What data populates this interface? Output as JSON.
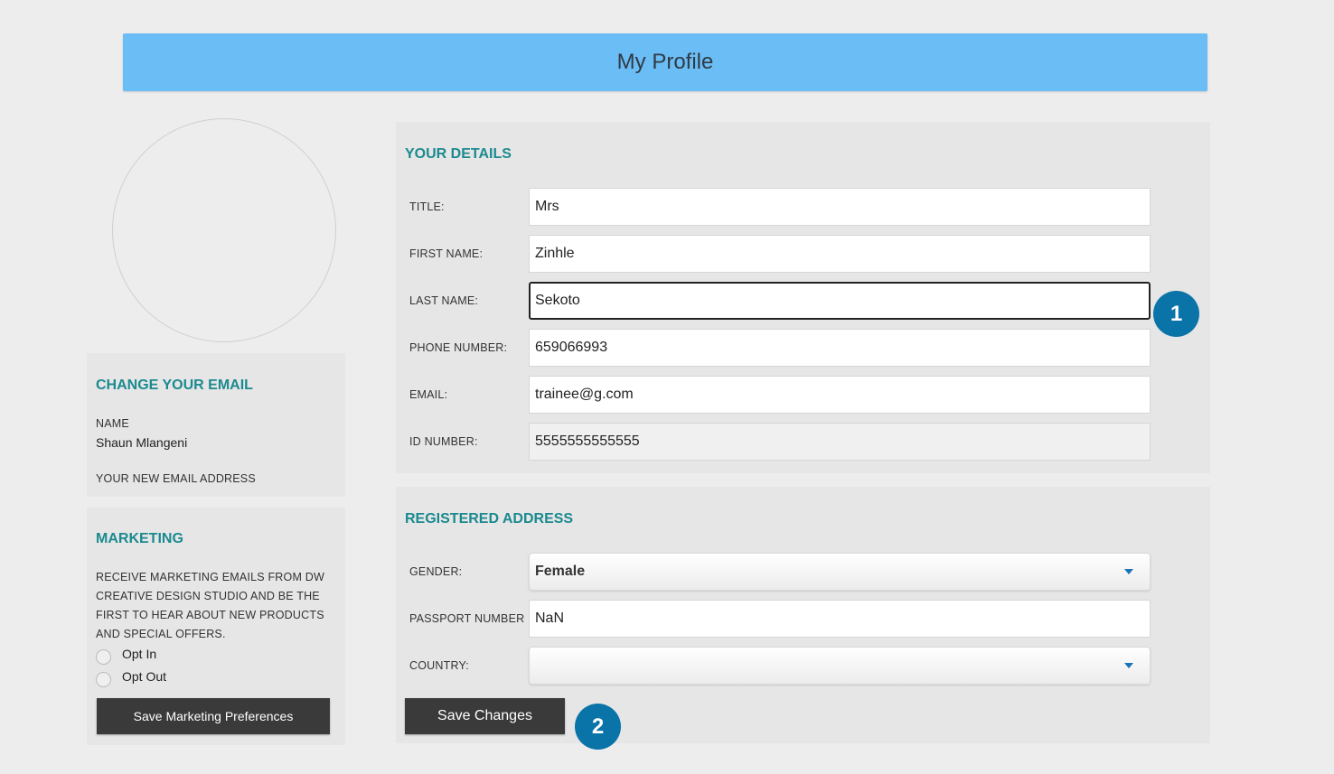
{
  "header": {
    "title": "My Profile"
  },
  "email_section": {
    "heading": "CHANGE YOUR EMAIL",
    "name_label": "NAME",
    "name_value": "Shaun Mlangeni",
    "new_email_label": "YOUR NEW EMAIL ADDRESS"
  },
  "marketing": {
    "heading": "MARKETING",
    "description": "RECEIVE MARKETING EMAILS FROM DW CREATIVE DESIGN STUDIO AND BE THE FIRST TO HEAR ABOUT NEW PRODUCTS AND SPECIAL OFFERS.",
    "options": [
      "Opt In",
      "Opt Out"
    ],
    "save_label": "Save Marketing Preferences"
  },
  "details": {
    "heading": "YOUR DETAILS",
    "fields": [
      {
        "label": "TITLE:",
        "value": "Mrs"
      },
      {
        "label": "FIRST NAME:",
        "value": "Zinhle"
      },
      {
        "label": "LAST NAME:",
        "value": "Sekoto"
      },
      {
        "label": "PHONE NUMBER:",
        "value": "659066993"
      },
      {
        "label": "EMAIL:",
        "value": "trainee@g.com"
      },
      {
        "label": "ID NUMBER:",
        "value": "5555555555555"
      }
    ]
  },
  "address": {
    "heading": "REGISTERED ADDRESS",
    "gender_label": "GENDER:",
    "gender_value": "Female",
    "passport_label": "PASSPORT NUMBER",
    "passport_value": "NaN",
    "country_label": "COUNTRY:",
    "country_value": "",
    "save_label": "Save Changes"
  },
  "badges": [
    "1",
    "2"
  ],
  "colors": {
    "header": "#6bbdf5",
    "heading": "#1b8a8f",
    "badge": "#0a73a8",
    "button": "#3a3a3a"
  }
}
